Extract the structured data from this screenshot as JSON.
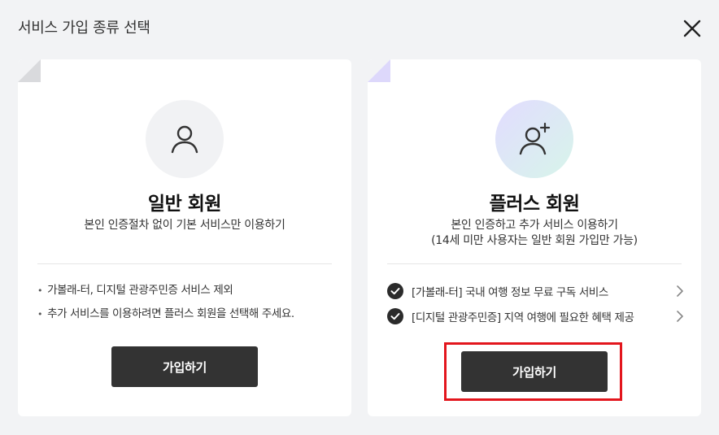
{
  "modal": {
    "title": "서비스 가입 종류 선택",
    "close_icon": "close-icon"
  },
  "cards": {
    "basic": {
      "icon": "user-icon",
      "title": "일반 회원",
      "description": "본인 인증절차 없이 기본 서비스만 이용하기",
      "notes": [
        "가볼래-터, 디지털 관광주민증 서비스 제외",
        "추가 서비스를 이용하려면 플러스 회원을 선택해 주세요."
      ],
      "button_label": "가입하기"
    },
    "plus": {
      "icon": "user-plus-icon",
      "title": "플러스 회원",
      "description_line1": "본인 인증하고 추가 서비스 이용하기",
      "description_line2": "(14세 미만 사용자는 일반 회원 가입만 가능)",
      "benefits": [
        "[가볼래-터] 국내 여행 정보 무료 구독 서비스",
        "[디지털 관광주민증] 지역 여행에 필요한 혜택 제공"
      ],
      "button_label": "가입하기"
    }
  },
  "colors": {
    "background": "#f2f3f5",
    "button": "#333333",
    "highlight": "#e3161d",
    "plus_gradient_start": "#e2dcff",
    "plus_gradient_end": "#d7f5ea"
  }
}
